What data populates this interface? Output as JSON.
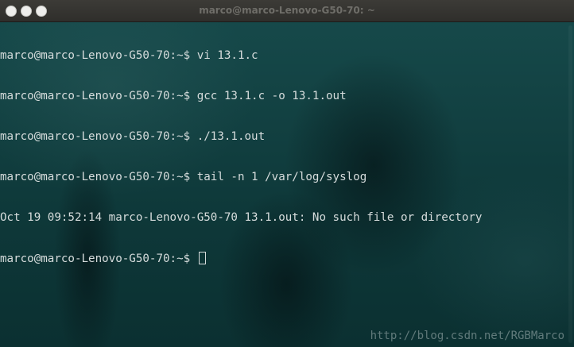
{
  "window": {
    "title": "marco@marco-Lenovo-G50-70: ~",
    "buttons": [
      "close-icon",
      "minimize-icon",
      "maximize-icon"
    ]
  },
  "terminal": {
    "lines": [
      {
        "prompt": "marco@marco-Lenovo-G50-70:~$ ",
        "text": "vi 13.1.c"
      },
      {
        "prompt": "marco@marco-Lenovo-G50-70:~$ ",
        "text": "gcc 13.1.c -o 13.1.out"
      },
      {
        "prompt": "marco@marco-Lenovo-G50-70:~$ ",
        "text": "./13.1.out"
      },
      {
        "prompt": "marco@marco-Lenovo-G50-70:~$ ",
        "text": "tail -n 1 /var/log/syslog"
      },
      {
        "prompt": "",
        "text": "Oct 19 09:52:14 marco-Lenovo-G50-70 13.1.out: No such file or directory"
      },
      {
        "prompt": "marco@marco-Lenovo-G50-70:~$ ",
        "text": ""
      }
    ]
  },
  "watermark": "http://blog.csdn.net/RGBMarco",
  "colors": {
    "titlebar": "#3c3b37",
    "terminal_bg": "#0f3a3b",
    "text": "#d6dcdc"
  }
}
